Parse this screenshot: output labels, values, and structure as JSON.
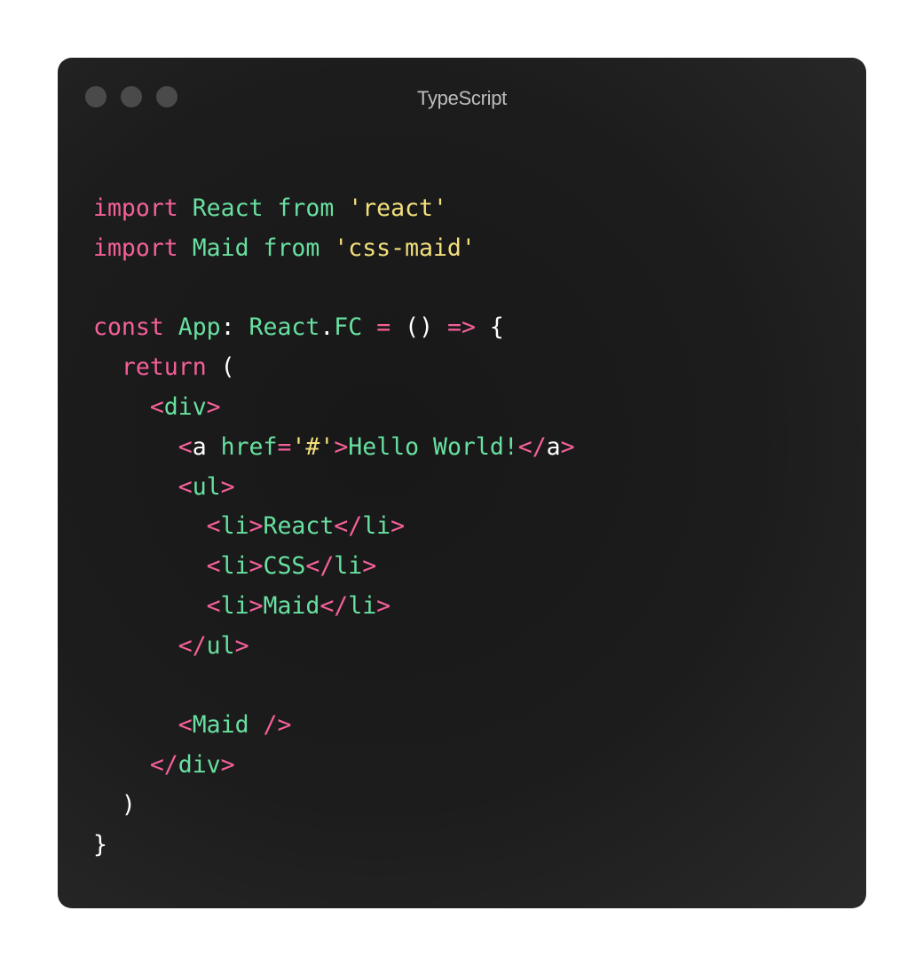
{
  "window": {
    "title": "TypeScript",
    "traffic_lights": [
      "close-dot",
      "minimize-dot",
      "maximize-dot"
    ]
  },
  "colors": {
    "keyword": "#f5609a",
    "identifier": "#68e0a0",
    "string": "#f3e07b",
    "plain": "#ffffff",
    "background": "#1c1c1c"
  },
  "code": {
    "lines": [
      [
        {
          "t": "import",
          "c": "kw"
        },
        {
          "t": " ",
          "c": "pl"
        },
        {
          "t": "React",
          "c": "id"
        },
        {
          "t": " ",
          "c": "pl"
        },
        {
          "t": "from",
          "c": "id"
        },
        {
          "t": " ",
          "c": "pl"
        },
        {
          "t": "'react'",
          "c": "str"
        }
      ],
      [
        {
          "t": "import",
          "c": "kw"
        },
        {
          "t": " ",
          "c": "pl"
        },
        {
          "t": "Maid",
          "c": "id"
        },
        {
          "t": " ",
          "c": "pl"
        },
        {
          "t": "from",
          "c": "id"
        },
        {
          "t": " ",
          "c": "pl"
        },
        {
          "t": "'css-maid'",
          "c": "str"
        }
      ],
      [],
      [
        {
          "t": "const",
          "c": "kw"
        },
        {
          "t": " ",
          "c": "pl"
        },
        {
          "t": "App",
          "c": "id"
        },
        {
          "t": ": ",
          "c": "pl"
        },
        {
          "t": "React",
          "c": "id"
        },
        {
          "t": ".",
          "c": "pl"
        },
        {
          "t": "FC",
          "c": "id"
        },
        {
          "t": " ",
          "c": "pl"
        },
        {
          "t": "=",
          "c": "kw"
        },
        {
          "t": " () ",
          "c": "pl"
        },
        {
          "t": "=>",
          "c": "kw"
        },
        {
          "t": " {",
          "c": "pl"
        }
      ],
      [
        {
          "t": "  ",
          "c": "pl"
        },
        {
          "t": "return",
          "c": "kw"
        },
        {
          "t": " (",
          "c": "pl"
        }
      ],
      [
        {
          "t": "    ",
          "c": "pl"
        },
        {
          "t": "<",
          "c": "tg"
        },
        {
          "t": "div",
          "c": "id"
        },
        {
          "t": ">",
          "c": "tg"
        }
      ],
      [
        {
          "t": "      ",
          "c": "pl"
        },
        {
          "t": "<",
          "c": "tg"
        },
        {
          "t": "a",
          "c": "pl"
        },
        {
          "t": " ",
          "c": "pl"
        },
        {
          "t": "href",
          "c": "id"
        },
        {
          "t": "=",
          "c": "kw"
        },
        {
          "t": "'#'",
          "c": "str"
        },
        {
          "t": ">",
          "c": "tg"
        },
        {
          "t": "Hello World!",
          "c": "id"
        },
        {
          "t": "</",
          "c": "tg"
        },
        {
          "t": "a",
          "c": "pl"
        },
        {
          "t": ">",
          "c": "tg"
        }
      ],
      [
        {
          "t": "      ",
          "c": "pl"
        },
        {
          "t": "<",
          "c": "tg"
        },
        {
          "t": "ul",
          "c": "id"
        },
        {
          "t": ">",
          "c": "tg"
        }
      ],
      [
        {
          "t": "        ",
          "c": "pl"
        },
        {
          "t": "<",
          "c": "tg"
        },
        {
          "t": "li",
          "c": "id"
        },
        {
          "t": ">",
          "c": "tg"
        },
        {
          "t": "React",
          "c": "id"
        },
        {
          "t": "</",
          "c": "tg"
        },
        {
          "t": "li",
          "c": "id"
        },
        {
          "t": ">",
          "c": "tg"
        }
      ],
      [
        {
          "t": "        ",
          "c": "pl"
        },
        {
          "t": "<",
          "c": "tg"
        },
        {
          "t": "li",
          "c": "id"
        },
        {
          "t": ">",
          "c": "tg"
        },
        {
          "t": "CSS",
          "c": "id"
        },
        {
          "t": "</",
          "c": "tg"
        },
        {
          "t": "li",
          "c": "id"
        },
        {
          "t": ">",
          "c": "tg"
        }
      ],
      [
        {
          "t": "        ",
          "c": "pl"
        },
        {
          "t": "<",
          "c": "tg"
        },
        {
          "t": "li",
          "c": "id"
        },
        {
          "t": ">",
          "c": "tg"
        },
        {
          "t": "Maid",
          "c": "id"
        },
        {
          "t": "</",
          "c": "tg"
        },
        {
          "t": "li",
          "c": "id"
        },
        {
          "t": ">",
          "c": "tg"
        }
      ],
      [
        {
          "t": "      ",
          "c": "pl"
        },
        {
          "t": "</",
          "c": "tg"
        },
        {
          "t": "ul",
          "c": "id"
        },
        {
          "t": ">",
          "c": "tg"
        }
      ],
      [],
      [
        {
          "t": "      ",
          "c": "pl"
        },
        {
          "t": "<",
          "c": "tg"
        },
        {
          "t": "Maid",
          "c": "id"
        },
        {
          "t": " ",
          "c": "pl"
        },
        {
          "t": "/>",
          "c": "tg"
        }
      ],
      [
        {
          "t": "    ",
          "c": "pl"
        },
        {
          "t": "</",
          "c": "tg"
        },
        {
          "t": "div",
          "c": "id"
        },
        {
          "t": ">",
          "c": "tg"
        }
      ],
      [
        {
          "t": "  )",
          "c": "pl"
        }
      ],
      [
        {
          "t": "}",
          "c": "pl"
        }
      ]
    ]
  }
}
